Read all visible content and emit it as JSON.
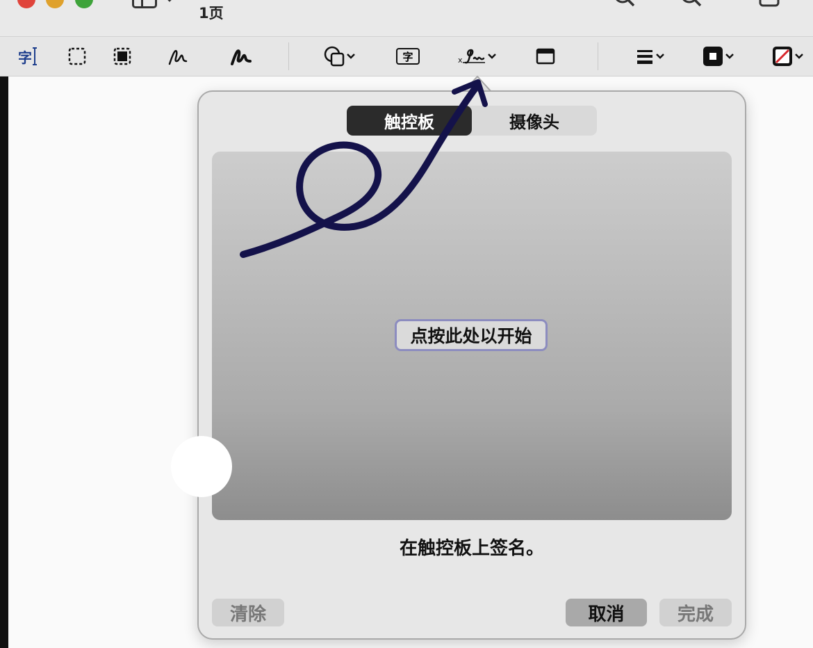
{
  "window": {
    "page_label": "1页",
    "controls": [
      "close",
      "minimize",
      "zoom"
    ]
  },
  "toolbar": {
    "tools": [
      {
        "name": "text-selection",
        "label": "字"
      },
      {
        "name": "rect-selection"
      },
      {
        "name": "smart-lasso"
      },
      {
        "name": "sketch"
      },
      {
        "name": "draw"
      },
      {
        "name": "shapes"
      },
      {
        "name": "text-box",
        "label": "字"
      },
      {
        "name": "sign"
      },
      {
        "name": "note"
      },
      {
        "name": "shape-style"
      },
      {
        "name": "border-color"
      },
      {
        "name": "fill-color"
      }
    ]
  },
  "signature_popover": {
    "tabs": [
      {
        "label": "触控板",
        "active": true
      },
      {
        "label": "摄像头",
        "active": false
      }
    ],
    "start_button": "点按此处以开始",
    "hint": "在触控板上签名。",
    "clear_button": "清除",
    "cancel_button": "取消",
    "done_button": "完成"
  },
  "colors": {
    "annotation_ink": "#14124a",
    "active_tab": "#2b2b2b",
    "focus_ring": "#8c8cbf"
  }
}
